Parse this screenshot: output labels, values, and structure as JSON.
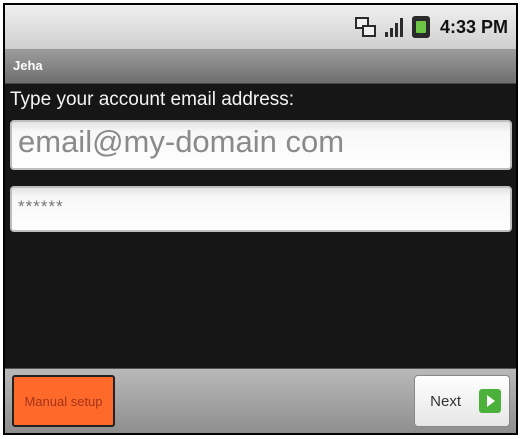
{
  "status_bar": {
    "time": "4:33 PM",
    "icons": [
      "network-3g-icon",
      "signal-icon",
      "battery-icon"
    ]
  },
  "app": {
    "title": "Jeha"
  },
  "form": {
    "prompt": "Type your account email address:",
    "email_placeholder": "email@my-domain com",
    "password_value": "******"
  },
  "buttons": {
    "manual_setup": "Manual setup",
    "next": "Next"
  },
  "colors": {
    "manual_button": "#ff6a2b",
    "next_arrow": "#4cb13b",
    "background": "#161616"
  }
}
